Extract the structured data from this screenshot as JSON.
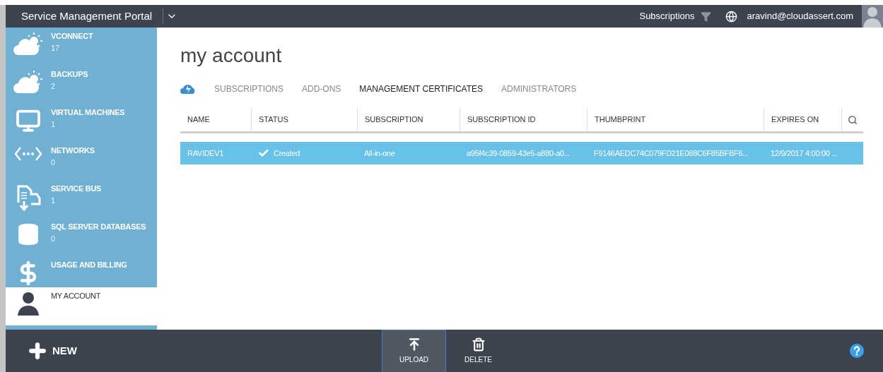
{
  "header": {
    "title": "Service Management Portal",
    "subscriptions_label": "Subscriptions",
    "user": "aravind@cloudassert.com"
  },
  "sidebar": {
    "items": [
      {
        "label": "VCONNECT",
        "count": "17",
        "selected": false
      },
      {
        "label": "BACKUPS",
        "count": "2",
        "selected": false
      },
      {
        "label": "VIRTUAL MACHINES",
        "count": "1",
        "selected": false
      },
      {
        "label": "NETWORKS",
        "count": "0",
        "selected": false
      },
      {
        "label": "SERVICE BUS",
        "count": "1",
        "selected": false
      },
      {
        "label": "SQL SERVER DATABASES",
        "count": "0",
        "selected": false
      },
      {
        "label": "USAGE AND BILLING",
        "selected": false
      },
      {
        "label": "MY ACCOUNT",
        "selected": true
      }
    ]
  },
  "page": {
    "title": "my account"
  },
  "tabs": [
    {
      "label": "SUBSCRIPTIONS",
      "selected": false
    },
    {
      "label": "ADD-ONS",
      "selected": false
    },
    {
      "label": "MANAGEMENT CERTIFICATES",
      "selected": true
    },
    {
      "label": "ADMINISTRATORS",
      "selected": false
    }
  ],
  "table": {
    "columns": [
      "NAME",
      "STATUS",
      "SUBSCRIPTION",
      "SUBSCRIPTION ID",
      "THUMBPRINT",
      "EXPIRES ON"
    ],
    "rows": [
      {
        "selected": true,
        "cells": [
          "RAVIDEV1",
          "Created",
          "All-in-one",
          "a95f4c39-0859-43e5-a880-a0...",
          "F9146AEDC74C079FD21E088C6F85BFBF6...",
          "12/9/2017 4:00:00 ..."
        ]
      }
    ]
  },
  "command_bar": {
    "new_label": "NEW",
    "actions": [
      {
        "label": "UPLOAD",
        "selected": true
      },
      {
        "label": "DELETE",
        "selected": false
      }
    ]
  }
}
